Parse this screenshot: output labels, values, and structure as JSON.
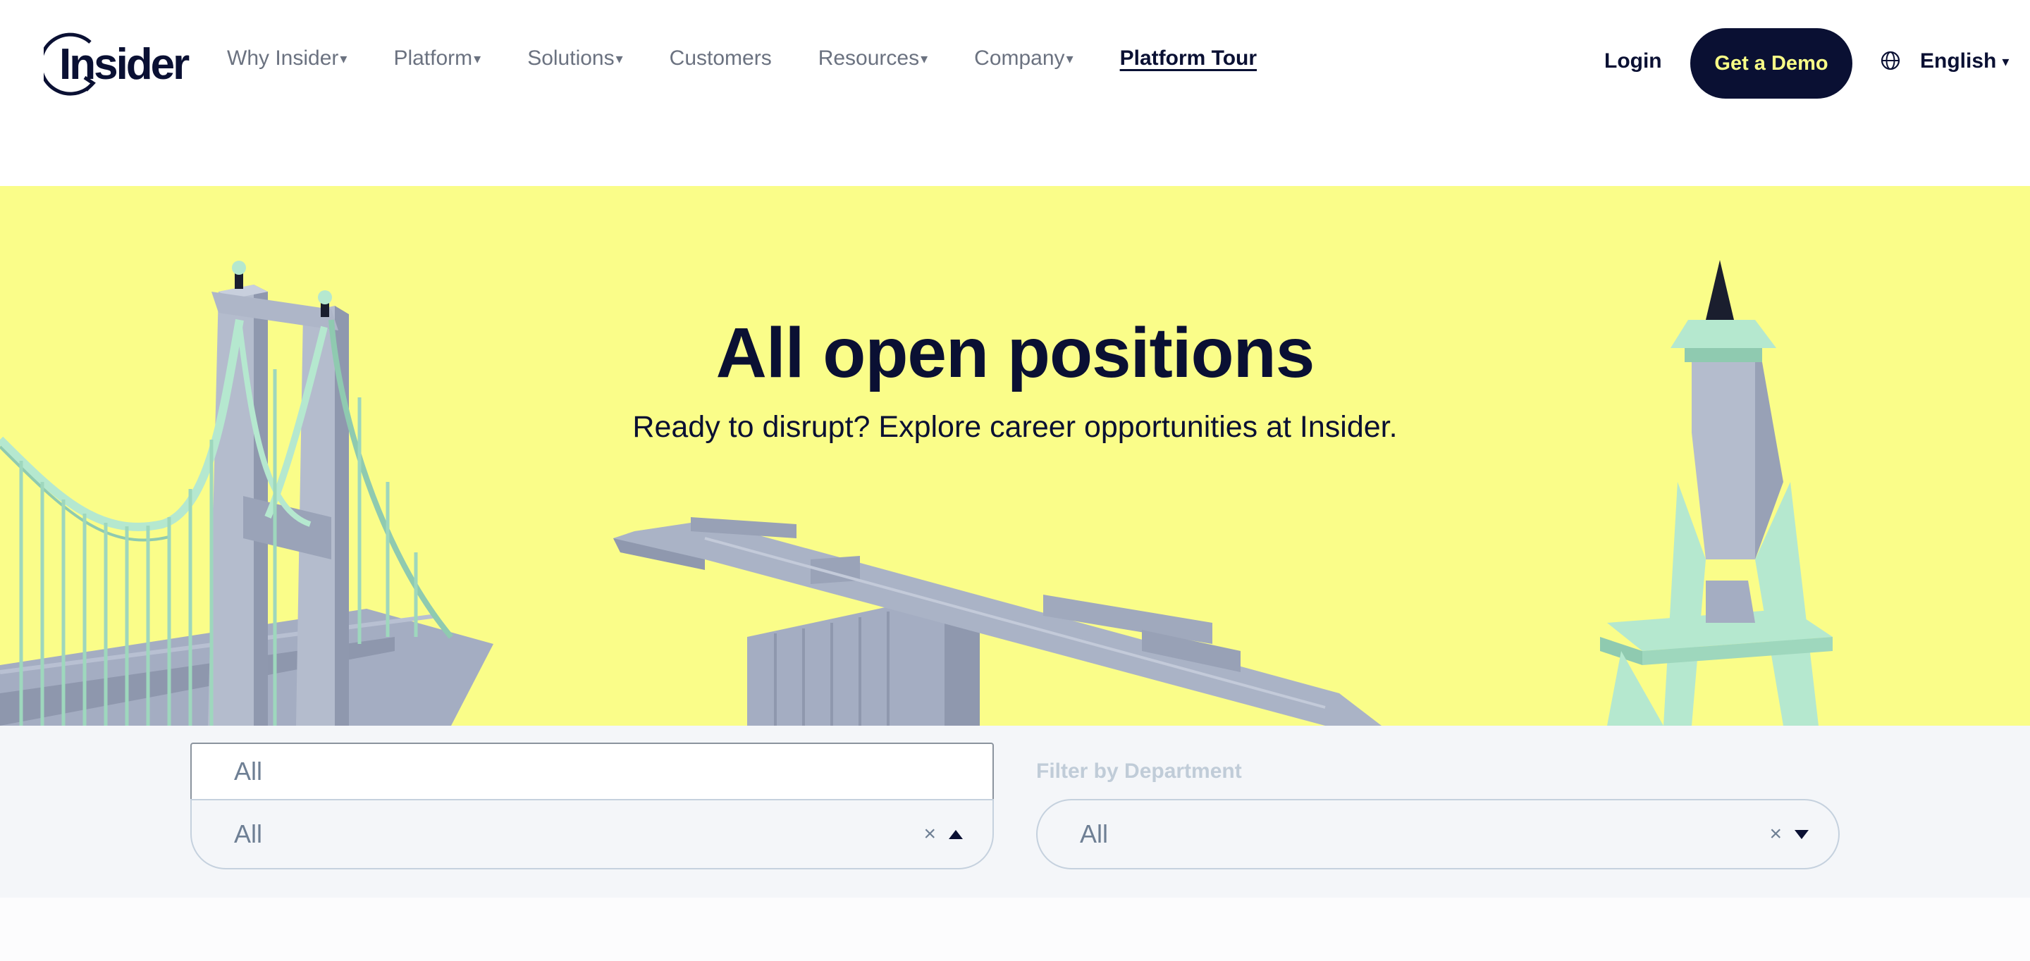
{
  "brand": {
    "logo_text": "Insider",
    "colors": {
      "navy": "#0a1033",
      "yellow": "#fafd89",
      "demo_text": "#faff87",
      "muted": "#6b7280",
      "structure_gray": "#a4adc2",
      "mint": "#b5e8cf"
    }
  },
  "header": {
    "nav": [
      {
        "label": "Why Insider",
        "has_dropdown": true
      },
      {
        "label": "Platform",
        "has_dropdown": true
      },
      {
        "label": "Solutions",
        "has_dropdown": true
      },
      {
        "label": "Customers",
        "has_dropdown": false
      },
      {
        "label": "Resources",
        "has_dropdown": true
      },
      {
        "label": "Company",
        "has_dropdown": true
      }
    ],
    "tour_label": "Platform Tour",
    "login_label": "Login",
    "demo_label": "Get a Demo",
    "language_icon": "globe-icon",
    "language_label": "English",
    "caret": "▾"
  },
  "hero": {
    "title": "All open positions",
    "subtitle": "Ready to disrupt? Explore career opportunities at Insider."
  },
  "filters": {
    "location": {
      "search_value": "All",
      "selected": "All",
      "clear_glyph": "×",
      "expanded": true
    },
    "department": {
      "label": "Filter by Department",
      "selected": "All",
      "clear_glyph": "×",
      "expanded": false
    }
  }
}
